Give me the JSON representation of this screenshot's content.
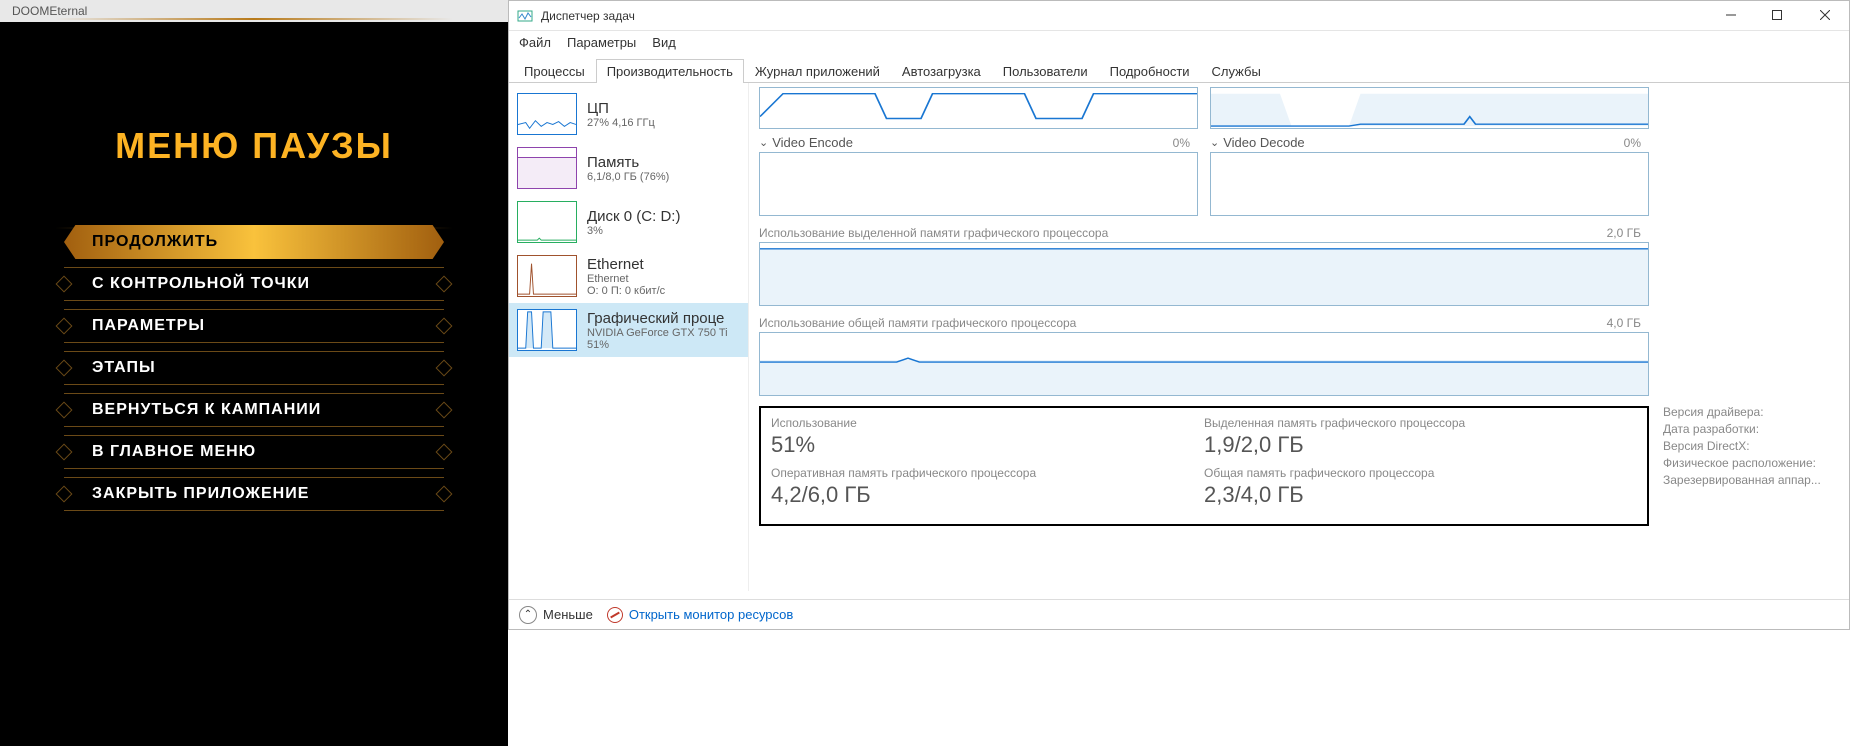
{
  "game": {
    "window_title": "DOOMEternal",
    "menu_title": "МЕНЮ ПАУЗЫ",
    "items": [
      {
        "label": "ПРОДОЛЖИТЬ",
        "active": true
      },
      {
        "label": "С КОНТРОЛЬНОЙ ТОЧКИ",
        "active": false
      },
      {
        "label": "ПАРАМЕТРЫ",
        "active": false
      },
      {
        "label": "ЭТАПЫ",
        "active": false
      },
      {
        "label": "ВЕРНУТЬСЯ К КАМПАНИИ",
        "active": false
      },
      {
        "label": "В ГЛАВНОЕ МЕНЮ",
        "active": false
      },
      {
        "label": "ЗАКРЫТЬ ПРИЛОЖЕНИЕ",
        "active": false
      }
    ]
  },
  "taskmgr": {
    "title": "Диспетчер задач",
    "menu": {
      "file": "Файл",
      "options": "Параметры",
      "view": "Вид"
    },
    "tabs": {
      "processes": "Процессы",
      "performance": "Производительность",
      "app_history": "Журнал приложений",
      "startup": "Автозагрузка",
      "users": "Пользователи",
      "details": "Подробности",
      "services": "Службы"
    },
    "sidebar": {
      "cpu": {
        "title": "ЦП",
        "sub": "27% 4,16 ГГц"
      },
      "memory": {
        "title": "Память",
        "sub": "6,1/8,0 ГБ (76%)"
      },
      "disk": {
        "title": "Диск 0 (C: D:)",
        "sub": "3%"
      },
      "ethernet": {
        "title": "Ethernet",
        "sub1": "Ethernet",
        "sub2": "О: 0 П: 0 кбит/с"
      },
      "gpu": {
        "title": "Графический проце",
        "sub1": "NVIDIA GeForce GTX 750 Ti",
        "sub2": "51%"
      }
    },
    "graphs": {
      "video_encode": {
        "label": "Video Encode",
        "pct": "0%"
      },
      "video_decode": {
        "label": "Video Decode",
        "pct": "0%"
      },
      "dedicated_mem": {
        "label": "Использование выделенной памяти графического процессора",
        "max": "2,0 ГБ"
      },
      "shared_mem": {
        "label": "Использование общей памяти графического процессора",
        "max": "4,0 ГБ"
      }
    },
    "stats": {
      "usage": {
        "label": "Использование",
        "value": "51%"
      },
      "gpu_ram": {
        "label": "Оперативная память графического процессора",
        "value": "4,2/6,0 ГБ"
      },
      "dedicated": {
        "label": "Выделенная память графического процессора",
        "value": "1,9/2,0 ГБ"
      },
      "shared": {
        "label": "Общая память графического процессора",
        "value": "2,3/4,0 ГБ"
      }
    },
    "details": {
      "driver_version": "Версия драйвера:",
      "driver_date": "Дата разработки:",
      "directx": "Версия DirectX:",
      "location": "Физическое расположение:",
      "reserved": "Зарезервированная аппар..."
    },
    "footer": {
      "less": "Меньше",
      "resmon": "Открыть монитор ресурсов"
    }
  }
}
